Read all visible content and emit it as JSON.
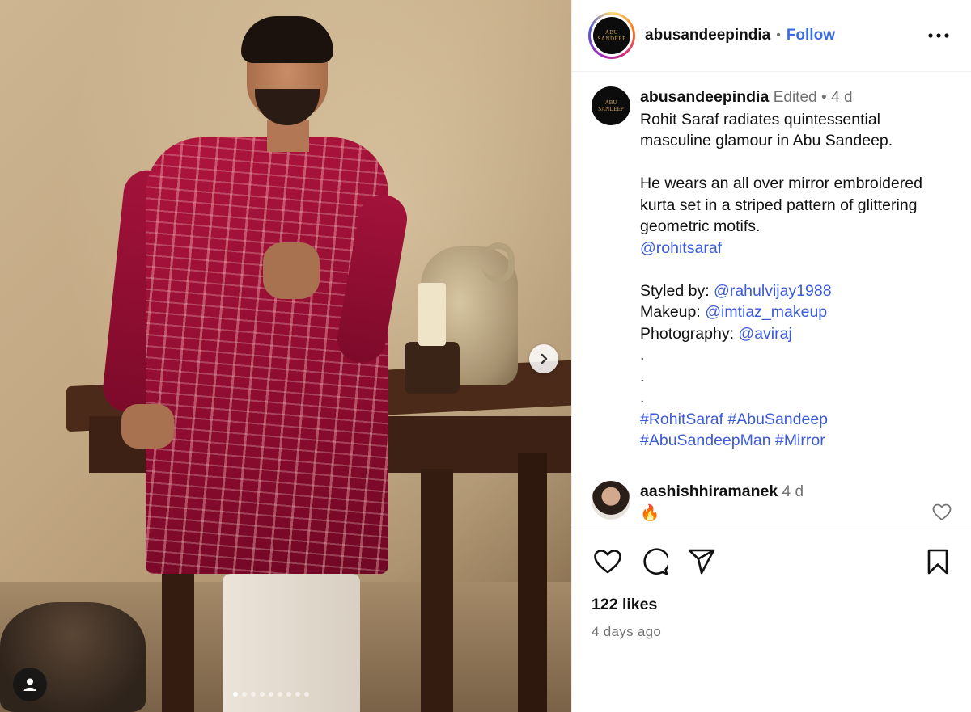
{
  "media": {
    "carousel": {
      "count": 9,
      "active_index": 0
    }
  },
  "header": {
    "logo_text_1": "ABU",
    "logo_text_2": "SANDEEP",
    "username": "abusandeepindia",
    "separator": "•",
    "follow_label": "Follow"
  },
  "caption": {
    "username": "abusandeepindia",
    "edited": "Edited",
    "separator": "•",
    "age": "4 d",
    "line1": "Rohit Saraf radiates quintessential masculine glamour in Abu Sandeep.",
    "line2": "He wears an all over mirror embroidered kurta set in a striped pattern of glittering geometric motifs.",
    "mention_main": "@rohitsaraf",
    "styled_label": "Styled by: ",
    "styled_handle": "@rahulvijay1988",
    "makeup_label": "Makeup: ",
    "makeup_handle": "@imtiaz_makeup",
    "photo_label": "Photography: ",
    "photo_handle": "@aviraj",
    "dot": ".",
    "hashtags_1": "#RohitSaraf #AbuSandeep",
    "hashtags_2": "#AbuSandeepMan #Mirror"
  },
  "comment": {
    "username": "aashishhiramanek",
    "age": "4 d",
    "text": "🔥"
  },
  "footer": {
    "likes": "122 likes",
    "time": "4 days ago"
  },
  "colors": {
    "link": "#3b5ad6",
    "follow": "#3b6ce4",
    "muted": "#737373"
  },
  "icons": [
    "chevron-right-icon",
    "user-tag-icon",
    "more-icon",
    "heart-icon",
    "comment-icon",
    "share-icon",
    "bookmark-icon"
  ]
}
